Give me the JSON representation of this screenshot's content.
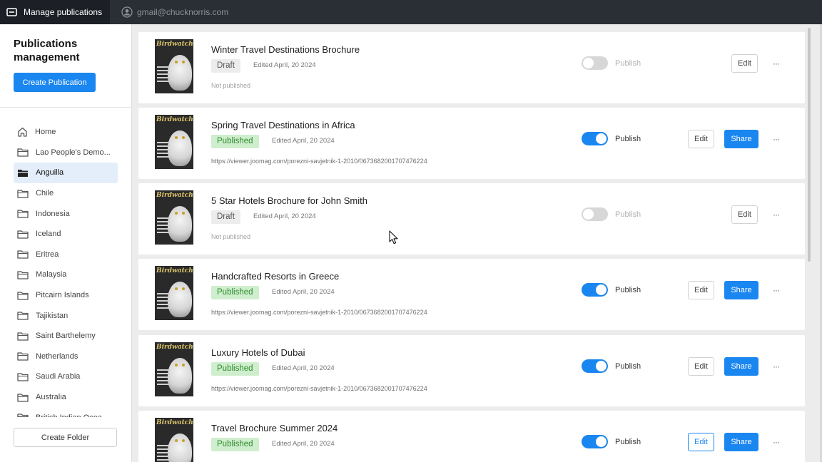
{
  "topbar": {
    "app_title": "Manage publications",
    "user_email": "gmail@chucknorris.com"
  },
  "sidebar": {
    "heading": "Publications management",
    "create_publication": "Create Publication",
    "create_folder": "Create Folder",
    "items": [
      {
        "label": "Home",
        "icon": "home-icon",
        "active": false
      },
      {
        "label": "Lao People's Demo...",
        "icon": "folder-icon",
        "active": false
      },
      {
        "label": "Anguilla",
        "icon": "folder-icon",
        "active": true
      },
      {
        "label": "Chile",
        "icon": "folder-icon",
        "active": false
      },
      {
        "label": "Indonesia",
        "icon": "folder-icon",
        "active": false
      },
      {
        "label": "Iceland",
        "icon": "folder-icon",
        "active": false
      },
      {
        "label": "Eritrea",
        "icon": "folder-icon",
        "active": false
      },
      {
        "label": "Malaysia",
        "icon": "folder-icon",
        "active": false
      },
      {
        "label": "Pitcairn Islands",
        "icon": "folder-icon",
        "active": false
      },
      {
        "label": "Tajikistan",
        "icon": "folder-icon",
        "active": false
      },
      {
        "label": "Saint Barthelemy",
        "icon": "folder-icon",
        "active": false
      },
      {
        "label": "Netherlands",
        "icon": "folder-icon",
        "active": false
      },
      {
        "label": "Saudi Arabia",
        "icon": "folder-icon",
        "active": false
      },
      {
        "label": "Australia",
        "icon": "folder-icon",
        "active": false
      },
      {
        "label": "British Indian Ocea",
        "icon": "folder-icon",
        "active": false
      }
    ]
  },
  "cover": {
    "masthead": "Birdwatcher"
  },
  "publish_label": "Publish",
  "edit_label": "Edit",
  "share_label": "Share",
  "more_label": "···",
  "publications": [
    {
      "title": "Winter Travel Destinations Brochure",
      "status": "Draft",
      "edited": "Edited April, 20 2024",
      "subtitle": "Not published",
      "published": false
    },
    {
      "title": "Spring Travel Destinations in Africa",
      "status": "Published",
      "edited": "Edited April, 20 2024",
      "subtitle": "https://viewer.joomag.com/porezni-savjetnik-1-2010/0673682001707476224",
      "published": true
    },
    {
      "title": "5 Star Hotels Brochure for John Smith",
      "status": "Draft",
      "edited": "Edited April, 20 2024",
      "subtitle": "Not published",
      "published": false
    },
    {
      "title": "Handcrafted Resorts in Greece",
      "status": "Published",
      "edited": "Edited April, 20 2024",
      "subtitle": "https://viewer.joomag.com/porezni-savjetnik-1-2010/0673682001707476224",
      "published": true
    },
    {
      "title": "Luxury Hotels of Dubai",
      "status": "Published",
      "edited": "Edited April, 20 2024",
      "subtitle": "https://viewer.joomag.com/porezni-savjetnik-1-2010/0673682001707476224",
      "published": true
    },
    {
      "title": "Travel Brochure Summer 2024",
      "status": "Published",
      "edited": "Edited April, 20 2024",
      "subtitle": "",
      "published": true
    }
  ],
  "colors": {
    "accent": "#1a86f0",
    "published_badge_bg": "#cfeecd",
    "published_badge_text": "#2e8a2e",
    "draft_badge_bg": "#ececec",
    "topbar_bg": "#2a2f36"
  }
}
